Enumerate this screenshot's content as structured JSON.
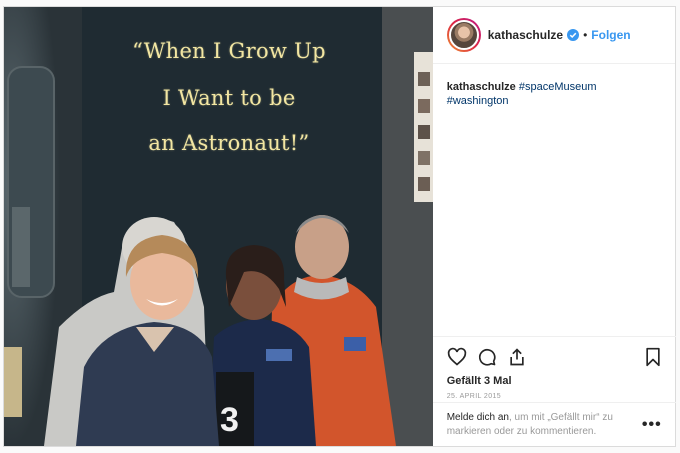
{
  "photo": {
    "quote_line1": "“When I Grow Up",
    "quote_line2": "I Want to be",
    "quote_line3": "an Astronaut!”",
    "number_sign": "3"
  },
  "header": {
    "username": "kathaschulze",
    "dot": "•",
    "follow_label": "Folgen"
  },
  "caption": {
    "username": "kathaschulze",
    "text": " #spaceMuseum #washington"
  },
  "actions": {
    "likes": "Gefällt 3 Mal",
    "date": "25. APRIL 2015"
  },
  "login": {
    "link": "Melde dich an",
    "text": ", um mit „Gefällt mir“ zu markieren oder zu kommentieren.",
    "more": "•••"
  },
  "icons": [
    "heart-icon",
    "comment-icon",
    "share-icon",
    "bookmark-icon",
    "verified-badge-icon"
  ],
  "colors": {
    "accent": "#3897f0",
    "quote_text": "#f2e6a2"
  }
}
